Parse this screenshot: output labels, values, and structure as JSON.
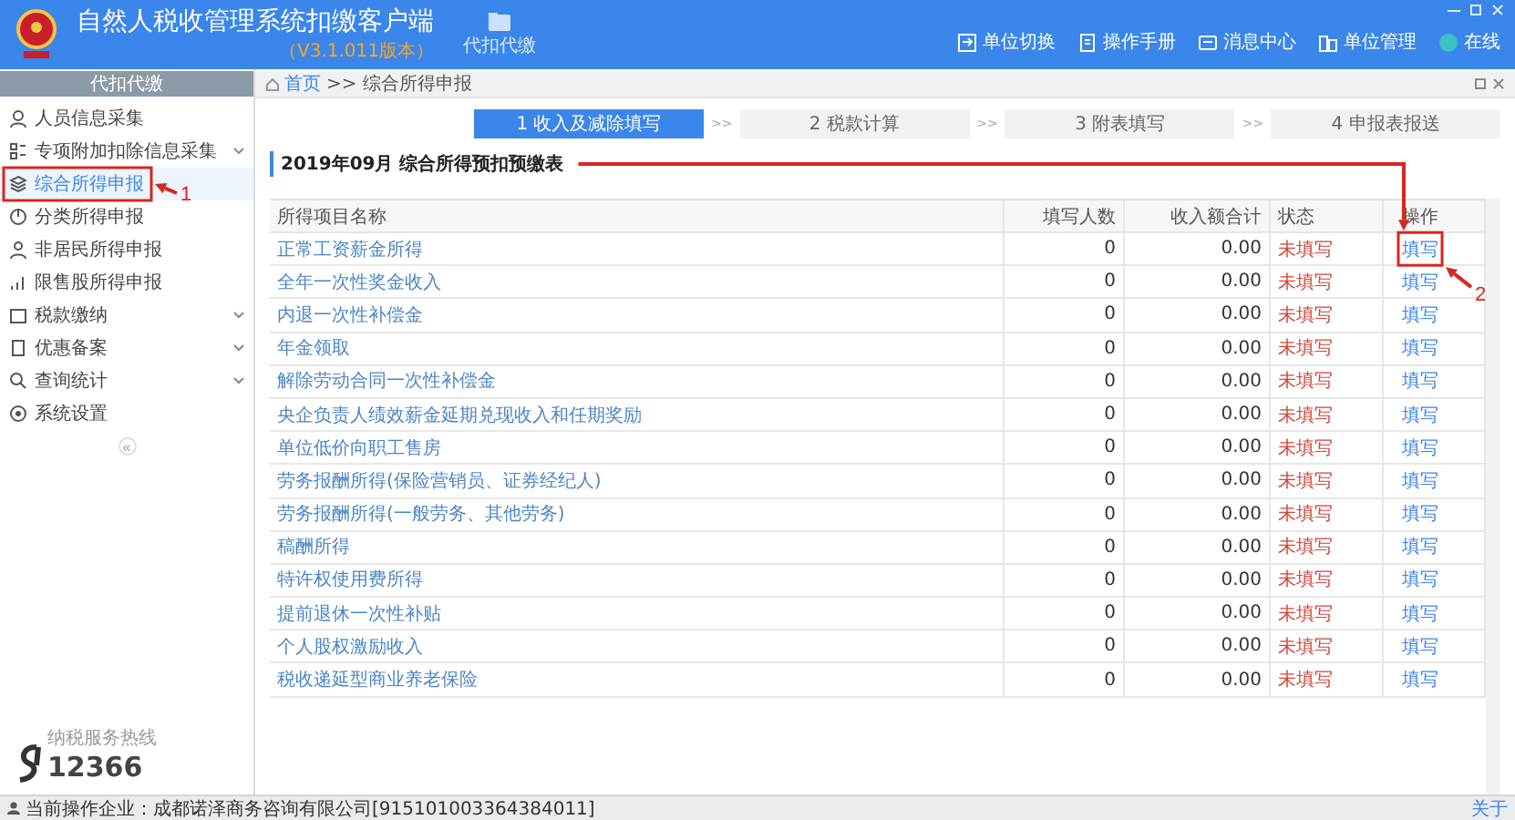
{
  "header": {
    "title": "自然人税收管理系统扣缴客户端",
    "version": "（V3.1.011版本）",
    "module": "代扣代缴",
    "actions": [
      {
        "label": "单位切换"
      },
      {
        "label": "操作手册"
      },
      {
        "label": "消息中心"
      },
      {
        "label": "单位管理"
      },
      {
        "label": "在线"
      }
    ]
  },
  "sidebar": {
    "title": "代扣代缴",
    "items": [
      {
        "label": "人员信息采集",
        "selected": false,
        "expandable": false
      },
      {
        "label": "专项附加扣除信息采集",
        "selected": false,
        "expandable": true
      },
      {
        "label": "综合所得申报",
        "selected": true,
        "expandable": false
      },
      {
        "label": "分类所得申报",
        "selected": false,
        "expandable": false
      },
      {
        "label": "非居民所得申报",
        "selected": false,
        "expandable": false
      },
      {
        "label": "限售股所得申报",
        "selected": false,
        "expandable": false
      },
      {
        "label": "税款缴纳",
        "selected": false,
        "expandable": true
      },
      {
        "label": "优惠备案",
        "selected": false,
        "expandable": true
      },
      {
        "label": "查询统计",
        "selected": false,
        "expandable": true
      },
      {
        "label": "系统设置",
        "selected": false,
        "expandable": false
      }
    ],
    "collapse": "«",
    "hotline_caption": "纳税服务热线",
    "hotline": "12366"
  },
  "breadcrumb": {
    "home": "首页",
    "separator": ">>",
    "current": "综合所得申报"
  },
  "steps": [
    {
      "label": "1 收入及减除填写",
      "selected": true
    },
    {
      "label": "2 税款计算",
      "selected": false
    },
    {
      "label": "3 附表填写",
      "selected": false
    },
    {
      "label": "4 申报表报送",
      "selected": false
    }
  ],
  "step_separators": [
    ">>",
    ">>",
    ">>"
  ],
  "table": {
    "title": "2019年09月  综合所得预扣预缴表",
    "columns": [
      "所得项目名称",
      "填写人数",
      "收入额合计",
      "状态",
      "操作"
    ],
    "rows": [
      {
        "name": "正常工资薪金所得",
        "count": "0",
        "income": "0.00",
        "status": "未填写",
        "action": "填写"
      },
      {
        "name": "全年一次性奖金收入",
        "count": "0",
        "income": "0.00",
        "status": "未填写",
        "action": "填写"
      },
      {
        "name": "内退一次性补偿金",
        "count": "0",
        "income": "0.00",
        "status": "未填写",
        "action": "填写"
      },
      {
        "name": "年金领取",
        "count": "0",
        "income": "0.00",
        "status": "未填写",
        "action": "填写"
      },
      {
        "name": "解除劳动合同一次性补偿金",
        "count": "0",
        "income": "0.00",
        "status": "未填写",
        "action": "填写"
      },
      {
        "name": "央企负责人绩效薪金延期兑现收入和任期奖励",
        "count": "0",
        "income": "0.00",
        "status": "未填写",
        "action": "填写"
      },
      {
        "name": "单位低价向职工售房",
        "count": "0",
        "income": "0.00",
        "status": "未填写",
        "action": "填写"
      },
      {
        "name": "劳务报酬所得(保险营销员、证券经纪人)",
        "count": "0",
        "income": "0.00",
        "status": "未填写",
        "action": "填写"
      },
      {
        "name": "劳务报酬所得(一般劳务、其他劳务)",
        "count": "0",
        "income": "0.00",
        "status": "未填写",
        "action": "填写"
      },
      {
        "name": "稿酬所得",
        "count": "0",
        "income": "0.00",
        "status": "未填写",
        "action": "填写"
      },
      {
        "name": "特许权使用费所得",
        "count": "0",
        "income": "0.00",
        "status": "未填写",
        "action": "填写"
      },
      {
        "name": "提前退休一次性补贴",
        "count": "0",
        "income": "0.00",
        "status": "未填写",
        "action": "填写"
      },
      {
        "name": "个人股权激励收入",
        "count": "0",
        "income": "0.00",
        "status": "未填写",
        "action": "填写"
      },
      {
        "name": "税收递延型商业养老保险",
        "count": "0",
        "income": "0.00",
        "status": "未填写",
        "action": "填写"
      }
    ]
  },
  "status_bar": {
    "company": "当前操作企业：成都诺泽商务咨询有限公司[915101003364384011]",
    "about": "关于"
  },
  "annotations": [
    {
      "label": "1"
    },
    {
      "label": "2"
    }
  ]
}
